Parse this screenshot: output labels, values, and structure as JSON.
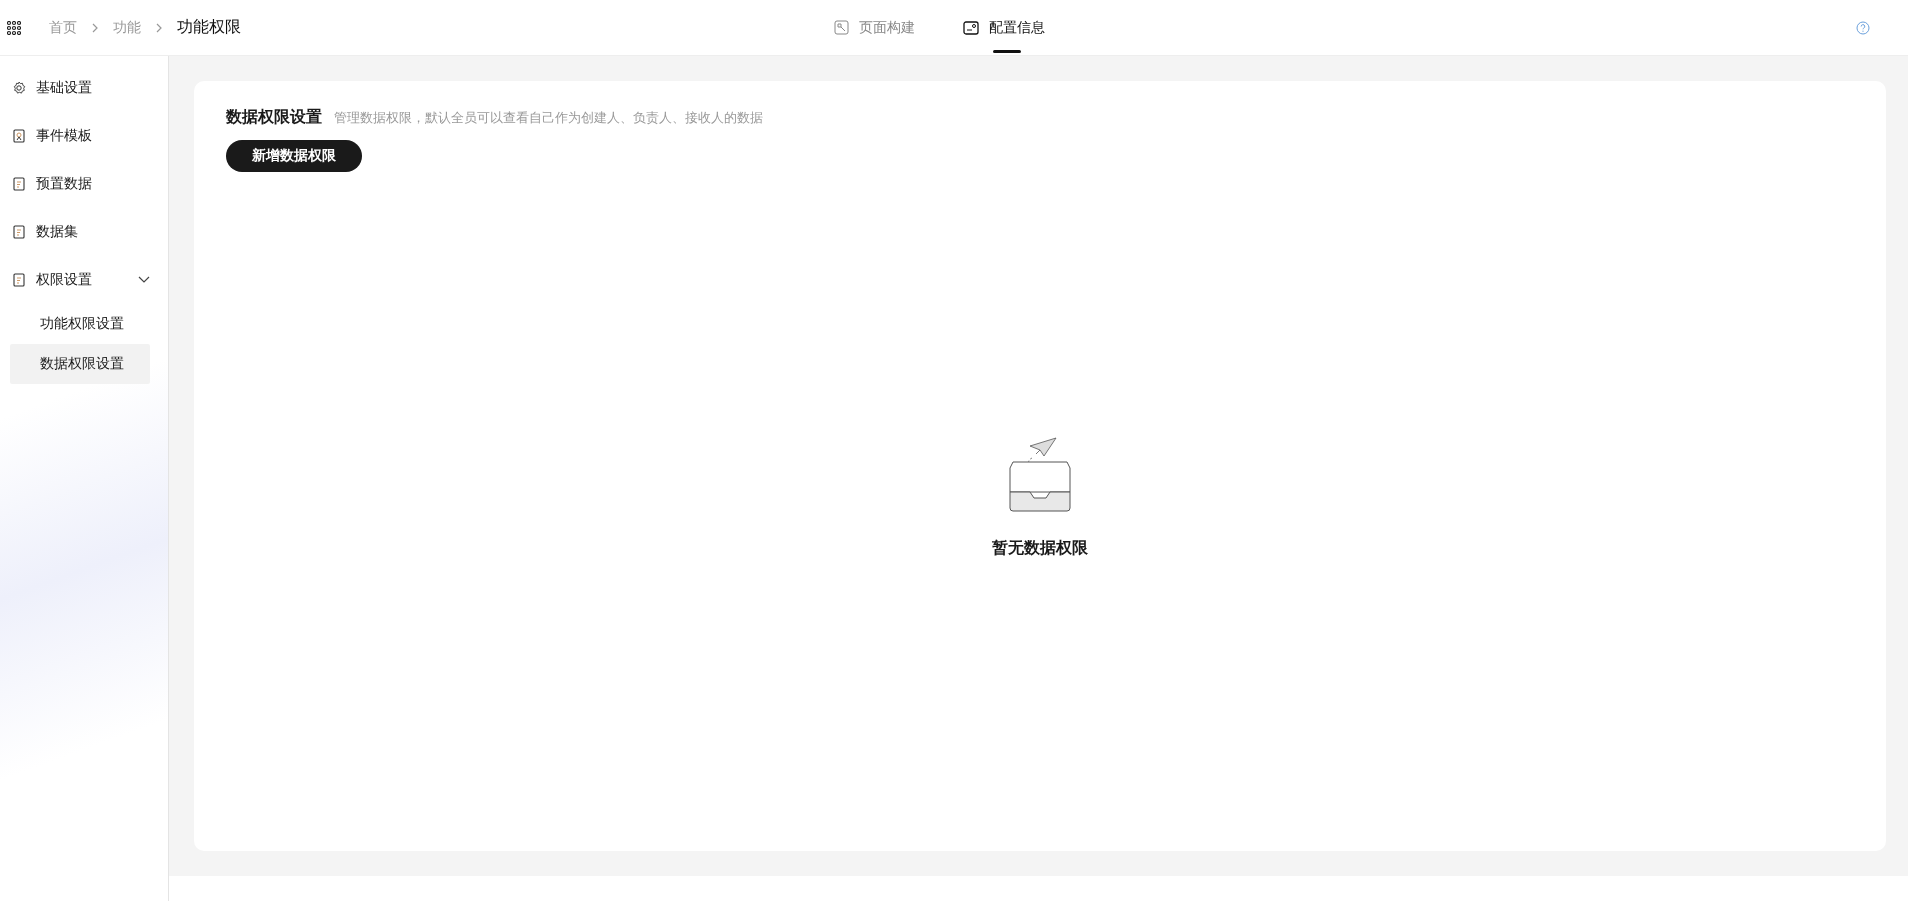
{
  "breadcrumb": [
    {
      "label": "首页",
      "current": false
    },
    {
      "label": "功能",
      "current": false
    },
    {
      "label": "功能权限",
      "current": true
    }
  ],
  "tabs": [
    {
      "label": "页面构建",
      "selected": false
    },
    {
      "label": "配置信息",
      "selected": true
    }
  ],
  "sidebar": {
    "items": [
      {
        "label": "基础设置"
      },
      {
        "label": "事件模板"
      },
      {
        "label": "预置数据"
      },
      {
        "label": "数据集"
      },
      {
        "label": "权限设置",
        "expanded": true,
        "children": [
          {
            "label": "功能权限设置",
            "selected": false
          },
          {
            "label": "数据权限设置",
            "selected": true
          }
        ]
      }
    ]
  },
  "panel": {
    "title": "数据权限设置",
    "description": "管理数据权限，默认全员可以查看自己作为创建人、负责人、接收人的数据",
    "add_button": "新增数据权限",
    "empty_text": "暂无数据权限"
  }
}
